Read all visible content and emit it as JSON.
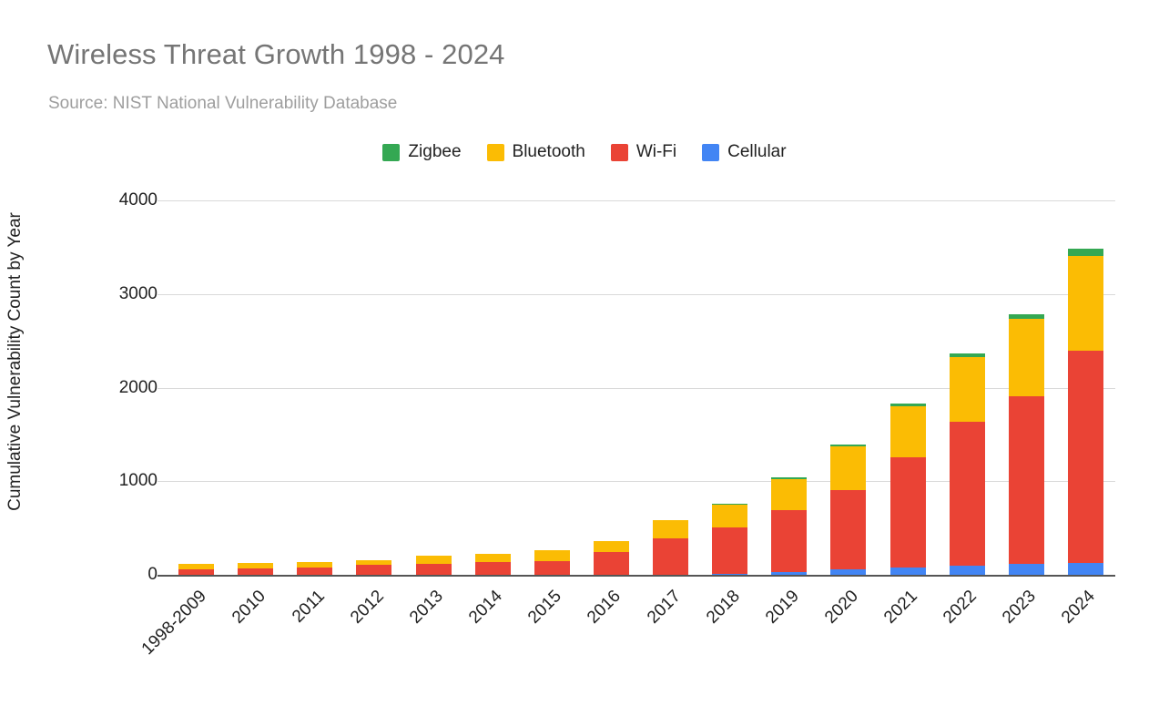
{
  "chart_data": {
    "type": "bar",
    "stacked": true,
    "title": "Wireless Threat Growth 1998 - 2024",
    "subtitle": "Source: NIST National Vulnerability Database",
    "xlabel": "",
    "ylabel": "Cumulative Vulnerability Count by Year",
    "ylim": [
      0,
      4000
    ],
    "yticks": [
      0,
      1000,
      2000,
      3000,
      4000
    ],
    "ytick_labels": [
      "0",
      "1000",
      "2000",
      "3000",
      "4000"
    ],
    "grid": true,
    "legend_position": "top-center",
    "xlabel_rotation": -45,
    "categories": [
      "1998-2009",
      "2010",
      "2011",
      "2012",
      "2013",
      "2014",
      "2015",
      "2016",
      "2017",
      "2018",
      "2019",
      "2020",
      "2021",
      "2022",
      "2023",
      "2024"
    ],
    "series": [
      {
        "name": "Cellular",
        "color": "#4285f4",
        "values": [
          0,
          0,
          0,
          0,
          0,
          0,
          0,
          0,
          0,
          10,
          30,
          55,
          75,
          95,
          115,
          130
        ]
      },
      {
        "name": "Wi-Fi",
        "color": "#ea4335",
        "values": [
          58,
          68,
          78,
          105,
          120,
          140,
          150,
          240,
          390,
          495,
          660,
          850,
          1180,
          1545,
          1795,
          2265
        ]
      },
      {
        "name": "Bluetooth",
        "color": "#fbbc04",
        "values": [
          58,
          62,
          62,
          55,
          85,
          80,
          115,
          120,
          195,
          240,
          335,
          465,
          545,
          690,
          825,
          1010
        ]
      },
      {
        "name": "Zigbee",
        "color": "#34a853",
        "values": [
          0,
          0,
          0,
          0,
          0,
          0,
          0,
          0,
          0,
          15,
          20,
          25,
          30,
          35,
          45,
          75
        ]
      }
    ],
    "totals": [
      116,
      130,
      140,
      160,
      205,
      220,
      265,
      360,
      585,
      760,
      1045,
      1395,
      1830,
      2365,
      2780,
      3480
    ]
  },
  "legend": {
    "items": [
      {
        "label": "Zigbee",
        "color": "#34a853"
      },
      {
        "label": "Bluetooth",
        "color": "#fbbc04"
      },
      {
        "label": "Wi-Fi",
        "color": "#ea4335"
      },
      {
        "label": "Cellular",
        "color": "#4285f4"
      }
    ]
  }
}
